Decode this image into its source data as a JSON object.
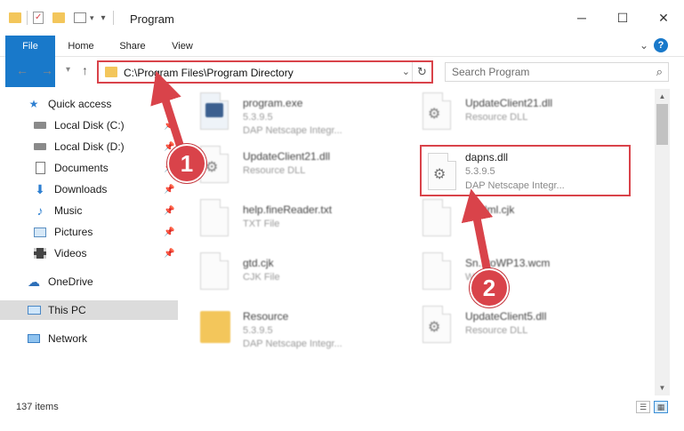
{
  "window": {
    "title": "Program",
    "controls": {
      "minimize": "─",
      "maximize": "☐",
      "close": "✕"
    }
  },
  "ribbon": {
    "tabs": [
      "File",
      "Home",
      "Share",
      "View"
    ],
    "expand_glyph": "⌄",
    "help": "?"
  },
  "address": {
    "path": "C:\\Program Files\\Program Directory",
    "search_placeholder": "Search Program"
  },
  "nav_pane": {
    "quick_access": "Quick access",
    "items": [
      {
        "label": "Local Disk (C:)",
        "icon": "drive-icon",
        "pinned": true
      },
      {
        "label": "Local Disk (D:)",
        "icon": "drive-icon",
        "pinned": true
      },
      {
        "label": "Documents",
        "icon": "documents-icon",
        "pinned": true
      },
      {
        "label": "Downloads",
        "icon": "downloads-icon",
        "pinned": true
      },
      {
        "label": "Music",
        "icon": "music-icon",
        "pinned": true
      },
      {
        "label": "Pictures",
        "icon": "pictures-icon",
        "pinned": true
      },
      {
        "label": "Videos",
        "icon": "videos-icon",
        "pinned": true
      }
    ],
    "onedrive": "OneDrive",
    "this_pc": "This PC",
    "network": "Network"
  },
  "files": [
    {
      "name": "program.exe",
      "l2": "5.3.9.5",
      "l3": "DAP Netscape Integr...",
      "icon": "exe-icon"
    },
    {
      "name": "UpdateClient21.dll",
      "l2": "Resource DLL",
      "l3": "",
      "icon": "dll-icon"
    },
    {
      "name": "UpdateClient21.dll",
      "l2": "Resource DLL",
      "l3": "",
      "icon": "dll-icon"
    },
    {
      "name": "dapns.dll",
      "l2": "5.3.9.5",
      "l3": "DAP Netscape Integr...",
      "icon": "dll-icon"
    },
    {
      "name": "help.fineReader.txt",
      "l2": "TXT File",
      "l3": "",
      "icon": "txt-icon"
    },
    {
      "name": "...Nml.cjk",
      "l2": "",
      "l3": "",
      "icon": "file-icon"
    },
    {
      "name": "gtd.cjk",
      "l2": "CJK File",
      "l3": "",
      "icon": "file-icon"
    },
    {
      "name": "Sn...toWP13.wcm",
      "l2": "W...",
      "l3": "",
      "icon": "file-icon"
    },
    {
      "name": "Resource",
      "l2": "5.3.9.5",
      "l3": "DAP Netscape Integr...",
      "icon": "folder-icon"
    },
    {
      "name": "UpdateClient5.dll",
      "l2": "Resource DLL",
      "l3": "",
      "icon": "dll-icon"
    }
  ],
  "status": {
    "count": "137 items"
  },
  "annotations": {
    "step1": "1",
    "step2": "2",
    "accent": "#d9434a"
  }
}
